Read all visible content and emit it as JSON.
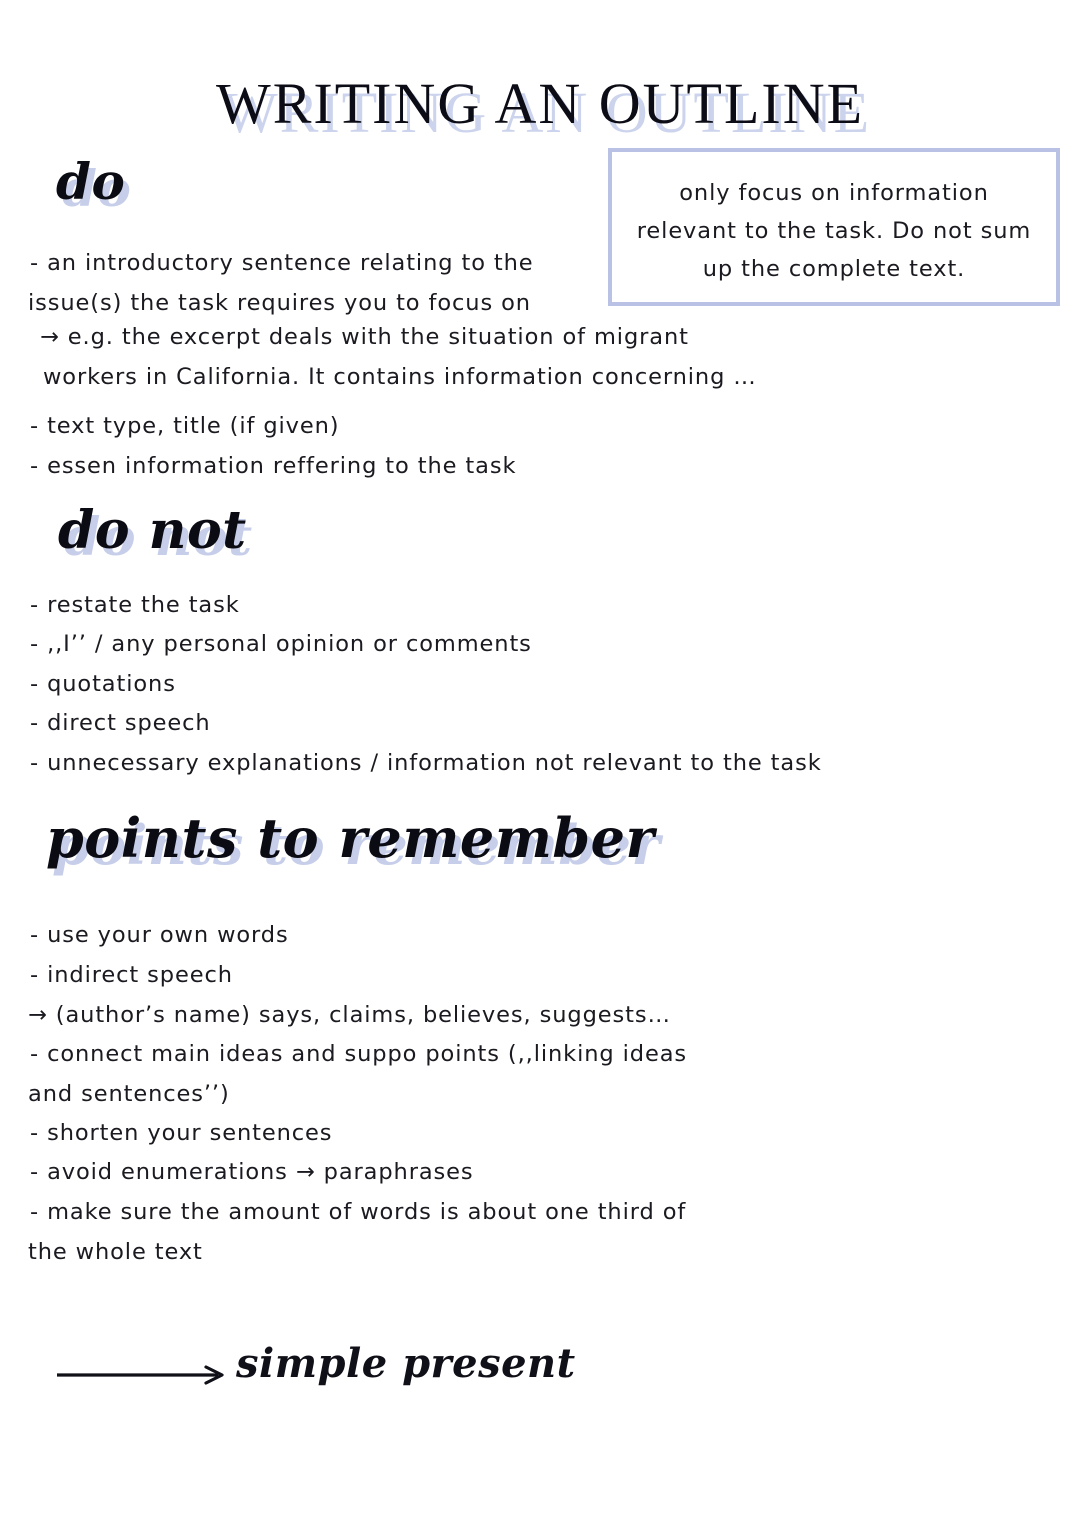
{
  "document": {
    "title": "WRITING AN OUTLINE",
    "background_color": "#ffffff",
    "text_color": "#1a1a20",
    "accent_color": "#b9c1e4",
    "shadow_color": "#c6cee9"
  },
  "callout": {
    "line1": "only focus on information",
    "line2": "relevant to the task. Do not sum",
    "line3": "up the complete text.",
    "border_color": "#b9c1e4"
  },
  "sections": {
    "do": {
      "heading": "do",
      "lines": [
        "- an introductory sentence relating to the",
        "issue(s) the task requires you to focus on",
        "→ e.g. the excerpt deals with the situation of migrant",
        "workers in California. It contains information concerning …",
        "- text type, title (if given)",
        "- essen information reffering to the task"
      ]
    },
    "do_not": {
      "heading": "do not",
      "lines": [
        "- restate the task",
        "- ,,I’’ / any personal opinion or comments",
        "- quotations",
        "- direct speech",
        "- unnecessary explanations / information not relevant to the task"
      ]
    },
    "points_to_remember": {
      "heading": "points to remember",
      "lines": [
        "- use your own words",
        "- indirect speech",
        "→ (author’s name) says, claims, believes, suggests…",
        "- connect main ideas and suppo points (,,linking ideas",
        "and sentences’’)",
        "- shorten your sentences",
        "- avoid enumerations → paraphrases",
        "- make sure the amount of words is about one third of",
        "the whole text"
      ]
    }
  },
  "footer": {
    "label": "simple present",
    "arrow": "long-right-arrow"
  }
}
